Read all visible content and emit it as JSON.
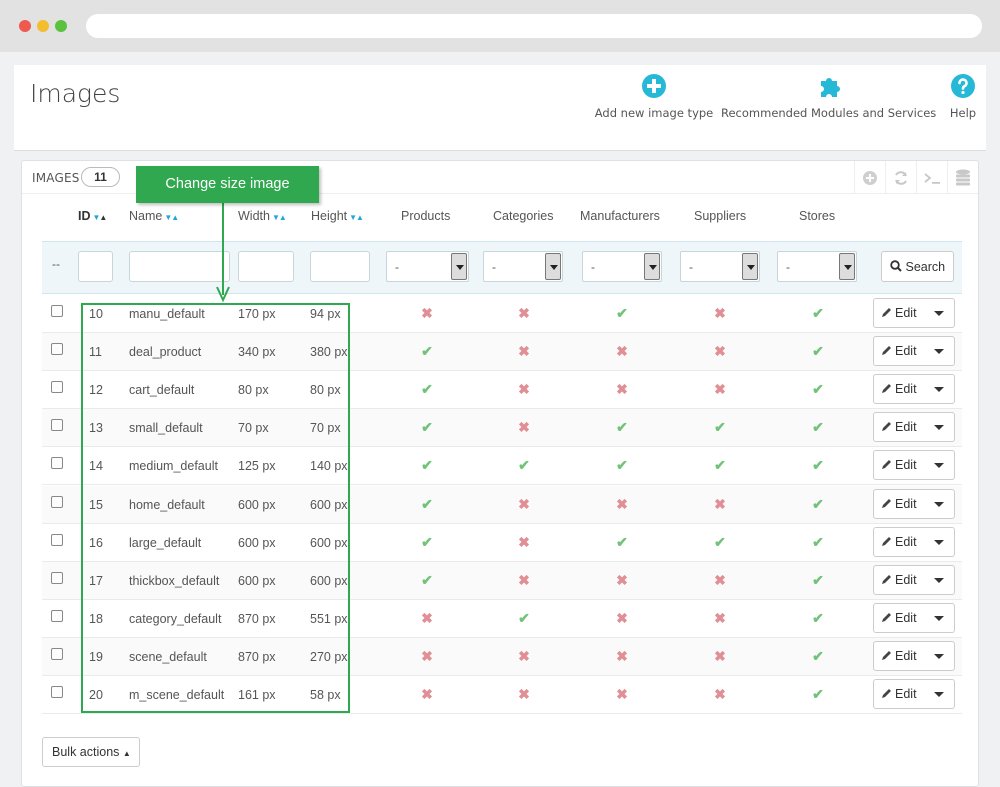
{
  "page": {
    "title": "Images"
  },
  "toolbar": {
    "add": {
      "label": "Add new image type",
      "icon": "plus-circle-icon"
    },
    "recommended": {
      "label": "Recommended Modules and Services",
      "icon": "puzzle-icon"
    },
    "help": {
      "label": "Help",
      "icon": "question-circle-icon"
    },
    "accent": "#25b9d7"
  },
  "panel": {
    "title": "IMAGES",
    "count": "11",
    "actions": [
      "add-icon",
      "refresh-icon",
      "sql-query-icon",
      "export-database-icon"
    ]
  },
  "columns": {
    "id": "ID",
    "name": "Name",
    "width": "Width",
    "height": "Height",
    "products": "Products",
    "categories": "Categories",
    "manufacturers": "Manufacturers",
    "suppliers": "Suppliers",
    "stores": "Stores"
  },
  "filters": {
    "row_dash": "--",
    "select_value": "-",
    "search_label": "Search"
  },
  "rows": [
    {
      "id": "10",
      "name": "manu_default",
      "width": "170 px",
      "height": "94 px",
      "products": false,
      "categories": false,
      "manufacturers": true,
      "suppliers": false,
      "stores": true
    },
    {
      "id": "11",
      "name": "deal_product",
      "width": "340 px",
      "height": "380 px",
      "products": true,
      "categories": false,
      "manufacturers": false,
      "suppliers": false,
      "stores": true
    },
    {
      "id": "12",
      "name": "cart_default",
      "width": "80 px",
      "height": "80 px",
      "products": true,
      "categories": false,
      "manufacturers": false,
      "suppliers": false,
      "stores": true
    },
    {
      "id": "13",
      "name": "small_default",
      "width": "70 px",
      "height": "70 px",
      "products": true,
      "categories": false,
      "manufacturers": true,
      "suppliers": true,
      "stores": true
    },
    {
      "id": "14",
      "name": "medium_default",
      "width": "125 px",
      "height": "140 px",
      "products": true,
      "categories": true,
      "manufacturers": true,
      "suppliers": true,
      "stores": true
    },
    {
      "id": "15",
      "name": "home_default",
      "width": "600 px",
      "height": "600 px",
      "products": true,
      "categories": false,
      "manufacturers": false,
      "suppliers": false,
      "stores": true
    },
    {
      "id": "16",
      "name": "large_default",
      "width": "600 px",
      "height": "600 px",
      "products": true,
      "categories": false,
      "manufacturers": true,
      "suppliers": true,
      "stores": true
    },
    {
      "id": "17",
      "name": "thickbox_default",
      "width": "600 px",
      "height": "600 px",
      "products": true,
      "categories": false,
      "manufacturers": false,
      "suppliers": false,
      "stores": true
    },
    {
      "id": "18",
      "name": "category_default",
      "width": "870 px",
      "height": "551 px",
      "products": false,
      "categories": true,
      "manufacturers": false,
      "suppliers": false,
      "stores": true
    },
    {
      "id": "19",
      "name": "scene_default",
      "width": "870 px",
      "height": "270 px",
      "products": false,
      "categories": false,
      "manufacturers": false,
      "suppliers": false,
      "stores": true
    },
    {
      "id": "20",
      "name": "m_scene_default",
      "width": "161 px",
      "height": "58 px",
      "products": false,
      "categories": false,
      "manufacturers": false,
      "suppliers": false,
      "stores": true
    }
  ],
  "row_action": {
    "edit_label": "Edit"
  },
  "bulk": {
    "label": "Bulk actions"
  },
  "annotation": {
    "label": "Change size image",
    "color": "#2fa84f"
  },
  "status_colors": {
    "yes": "#72c279",
    "no": "#e08f95"
  }
}
